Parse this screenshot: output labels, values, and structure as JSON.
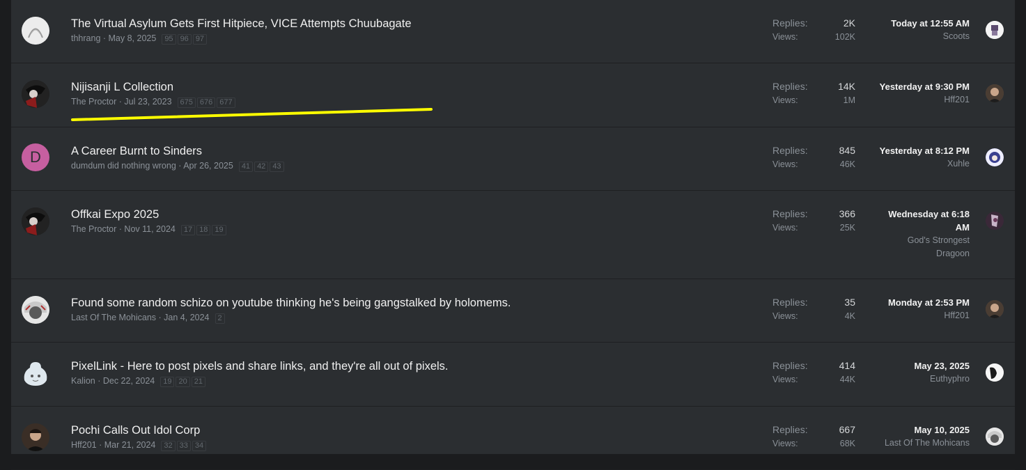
{
  "labels": {
    "replies": "Replies:",
    "views": "Views:"
  },
  "threads": [
    {
      "title": "The Virtual Asylum Gets First Hitpiece, VICE Attempts Chuubagate",
      "author": "thhrang",
      "date": "May 8, 2025",
      "pages": [
        "95",
        "96",
        "97"
      ],
      "replies": "2K",
      "views": "102K",
      "last_when": "Today at 12:55 AM",
      "last_user": "Scoots",
      "avatar_icon": "sketch-portrait-avatar"
    },
    {
      "title": "Nijisanji L Collection",
      "author": "The Proctor",
      "date": "Jul 23, 2023",
      "pages": [
        "675",
        "676",
        "677"
      ],
      "replies": "14K",
      "views": "1M",
      "last_when": "Yesterday at 9:30 PM",
      "last_user": "Hff201",
      "avatar_icon": "dark-anime-avatar"
    },
    {
      "title": "A Career Burnt to Sinders",
      "author": "dumdum did nothing wrong",
      "date": "Apr 26, 2025",
      "pages": [
        "41",
        "42",
        "43"
      ],
      "replies": "845",
      "views": "46K",
      "last_when": "Yesterday at 8:12 PM",
      "last_user": "Xuhle",
      "avatar_letter": "D"
    },
    {
      "title": "Offkai Expo 2025",
      "author": "The Proctor",
      "date": "Nov 11, 2024",
      "pages": [
        "17",
        "18",
        "19"
      ],
      "replies": "366",
      "views": "25K",
      "last_when": "Wednesday at 6:18 AM",
      "last_user": "God's Strongest Dragoon",
      "avatar_icon": "dark-anime-avatar"
    },
    {
      "title": "Found some random schizo on youtube thinking he's being gangstalked by holomems.",
      "author": "Last Of The Mohicans",
      "date": "Jan 4, 2024",
      "pages": [
        "2"
      ],
      "replies": "35",
      "views": "4K",
      "last_when": "Monday at 2:53 PM",
      "last_user": "Hff201",
      "avatar_icon": "anime-girl-avatar"
    },
    {
      "title": "PixelLink - Here to post pixels and share links, and they're all out of pixels.",
      "author": "Kalion",
      "date": "Dec 22, 2024",
      "pages": [
        "19",
        "20",
        "21"
      ],
      "replies": "414",
      "views": "44K",
      "last_when": "May 23, 2025",
      "last_user": "Euthyphro",
      "avatar_icon": "blob-mascot-avatar"
    },
    {
      "title": "Pochi Calls Out Idol Corp",
      "author": "Hff201",
      "date": "Mar 21, 2024",
      "pages": [
        "32",
        "33",
        "34"
      ],
      "replies": "667",
      "views": "68K",
      "last_when": "May 10, 2025",
      "last_user": "Last Of The Mohicans",
      "avatar_icon": "man-portrait-avatar"
    }
  ],
  "colors": {
    "row_bg": "#2b2e31",
    "highlight": "#ffff00",
    "title": "#f0f0f0",
    "muted": "#8b9198"
  }
}
